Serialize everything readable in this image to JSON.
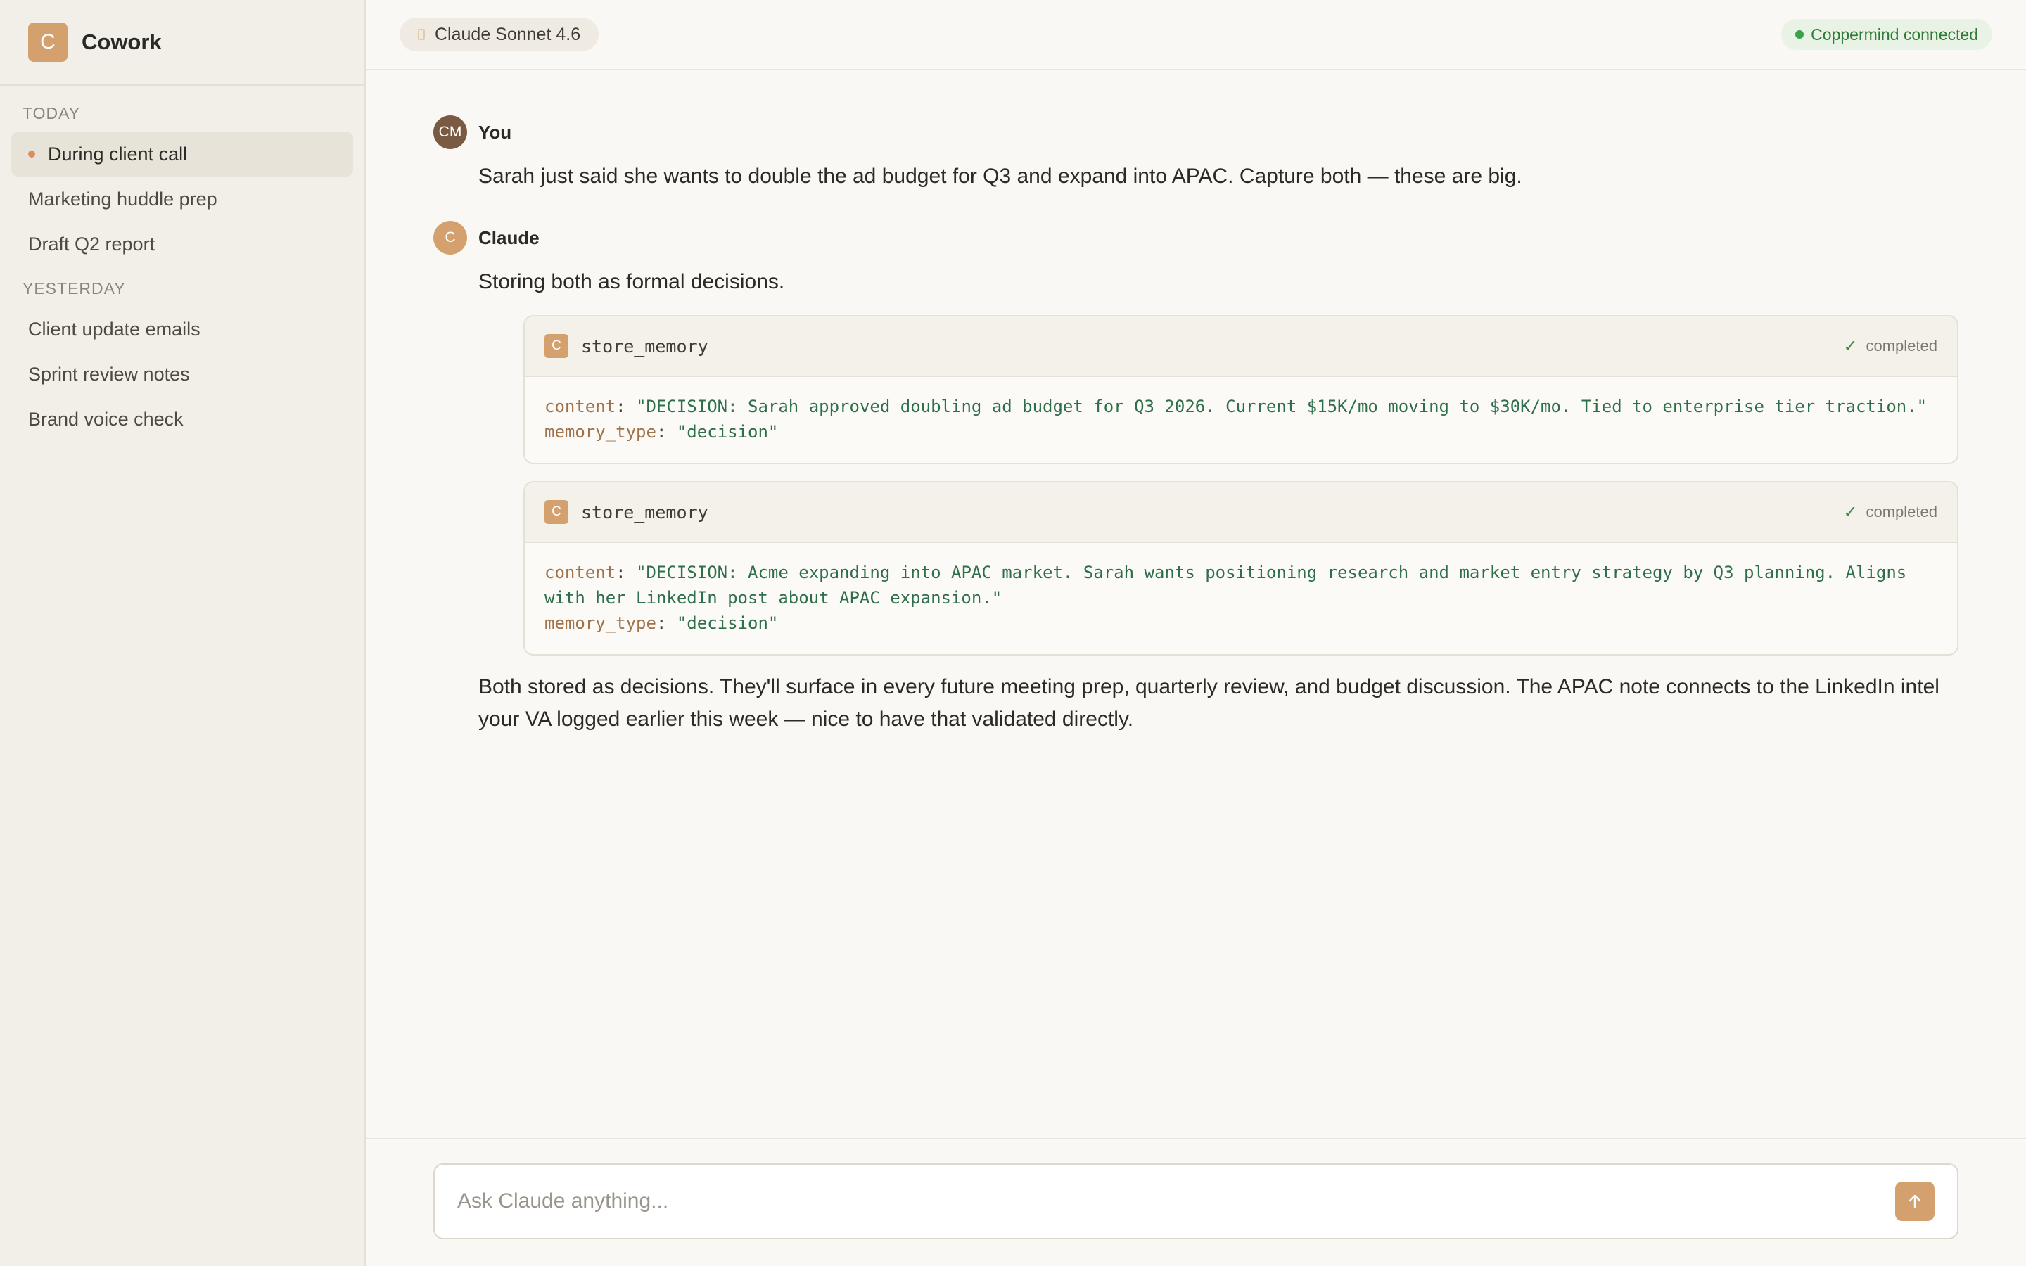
{
  "app": {
    "logo_letter": "C",
    "name": "Cowork"
  },
  "sidebar": {
    "sections": [
      {
        "label": "TODAY",
        "items": [
          {
            "label": "During client call",
            "active": true
          },
          {
            "label": "Marketing huddle prep"
          },
          {
            "label": "Draft Q2 report"
          }
        ]
      },
      {
        "label": "YESTERDAY",
        "items": [
          {
            "label": "Client update emails"
          },
          {
            "label": "Sprint review notes"
          },
          {
            "label": "Brand voice check"
          }
        ]
      }
    ]
  },
  "topbar": {
    "model_label": "Claude Sonnet 4.6",
    "connection_status": "Coppermind connected"
  },
  "conversation": {
    "user": {
      "avatar": "CM",
      "name": "You",
      "text": "Sarah just said she wants to double the ad budget for Q3 and expand into APAC. Capture both — these are big."
    },
    "assistant": {
      "avatar": "C",
      "name": "Claude",
      "intro": "Storing both as formal decisions.",
      "tool_calls": [
        {
          "icon_letter": "C",
          "name": "store_memory",
          "status": "completed",
          "args": [
            {
              "key": "content",
              "value": "\"DECISION: Sarah approved doubling ad budget for Q3 2026. Current $15K/mo moving to $30K/mo. Tied to enterprise tier traction.\""
            },
            {
              "key": "memory_type",
              "value": "\"decision\""
            }
          ]
        },
        {
          "icon_letter": "C",
          "name": "store_memory",
          "status": "completed",
          "args": [
            {
              "key": "content",
              "value": "\"DECISION: Acme expanding into APAC market. Sarah wants positioning research and market entry strategy by Q3 planning. Aligns with her LinkedIn post about APAC expansion.\""
            },
            {
              "key": "memory_type",
              "value": "\"decision\""
            }
          ]
        }
      ],
      "closing": "Both stored as decisions. They'll surface in every future meeting prep, quarterly review, and budget discussion. The APAC note connects to the LinkedIn intel your VA logged earlier this week — nice to have that validated directly."
    }
  },
  "composer": {
    "placeholder": "Ask Claude anything...",
    "send_icon": "arrow-up-icon"
  },
  "colors": {
    "accent": "#d4a16e",
    "sidebar_bg": "#f2efe8",
    "main_bg": "#f9f8f5",
    "status_green": "#3aa14a"
  }
}
